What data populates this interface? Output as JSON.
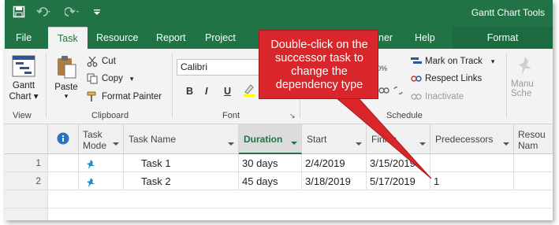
{
  "title_bar": {
    "context_tools": "Gantt Chart Tools",
    "qat_icons": [
      "save-icon",
      "undo-icon",
      "redo-icon",
      "customize-qat-icon"
    ]
  },
  "tabs": {
    "file": "File",
    "task": "Task",
    "resource": "Resource",
    "report": "Report",
    "project": "Project",
    "partial": "ner",
    "help": "Help",
    "format": "Format"
  },
  "ribbon": {
    "view_group": {
      "label": "View",
      "gantt_chart_l1": "Gantt",
      "gantt_chart_l2": "Chart ▾"
    },
    "clipboard_group": {
      "label": "Clipboard",
      "paste": "Paste",
      "cut": "Cut",
      "copy": "Copy",
      "format_painter": "Format Painter"
    },
    "font_group": {
      "label": "Font",
      "font_name": "Calibri",
      "bold": "B",
      "italic": "I",
      "underline": "U"
    },
    "schedule_group": {
      "label": "Schedule",
      "partial_pct": "0%",
      "mark_on_track": "Mark on Track",
      "respect_links": "Respect Links",
      "inactivate": "Inactivate"
    },
    "tasks_group": {
      "manual_l1": "Manu",
      "manual_l2": "Sche"
    }
  },
  "grid": {
    "headers": {
      "info": "i",
      "task_mode_l1": "Task",
      "task_mode_l2": "Mode",
      "task_name": "Task Name",
      "duration": "Duration",
      "start": "Start",
      "finish": "Finish",
      "predecessors": "Predecessors",
      "resource_l1": "Resou",
      "resource_l2": "Nam"
    },
    "rows": [
      {
        "id": "1",
        "name": "Task 1",
        "duration": "30 days",
        "start": "2/4/2019",
        "finish": "3/15/2019",
        "predecessors": ""
      },
      {
        "id": "2",
        "name": "Task 2",
        "duration": "45 days",
        "start": "3/18/2019",
        "finish": "5/17/2019",
        "predecessors": "1"
      }
    ]
  },
  "callout": {
    "text": "Double-click on the successor task to change the dependency type",
    "color": "#d9262b"
  },
  "colors": {
    "accent": "#217346"
  }
}
